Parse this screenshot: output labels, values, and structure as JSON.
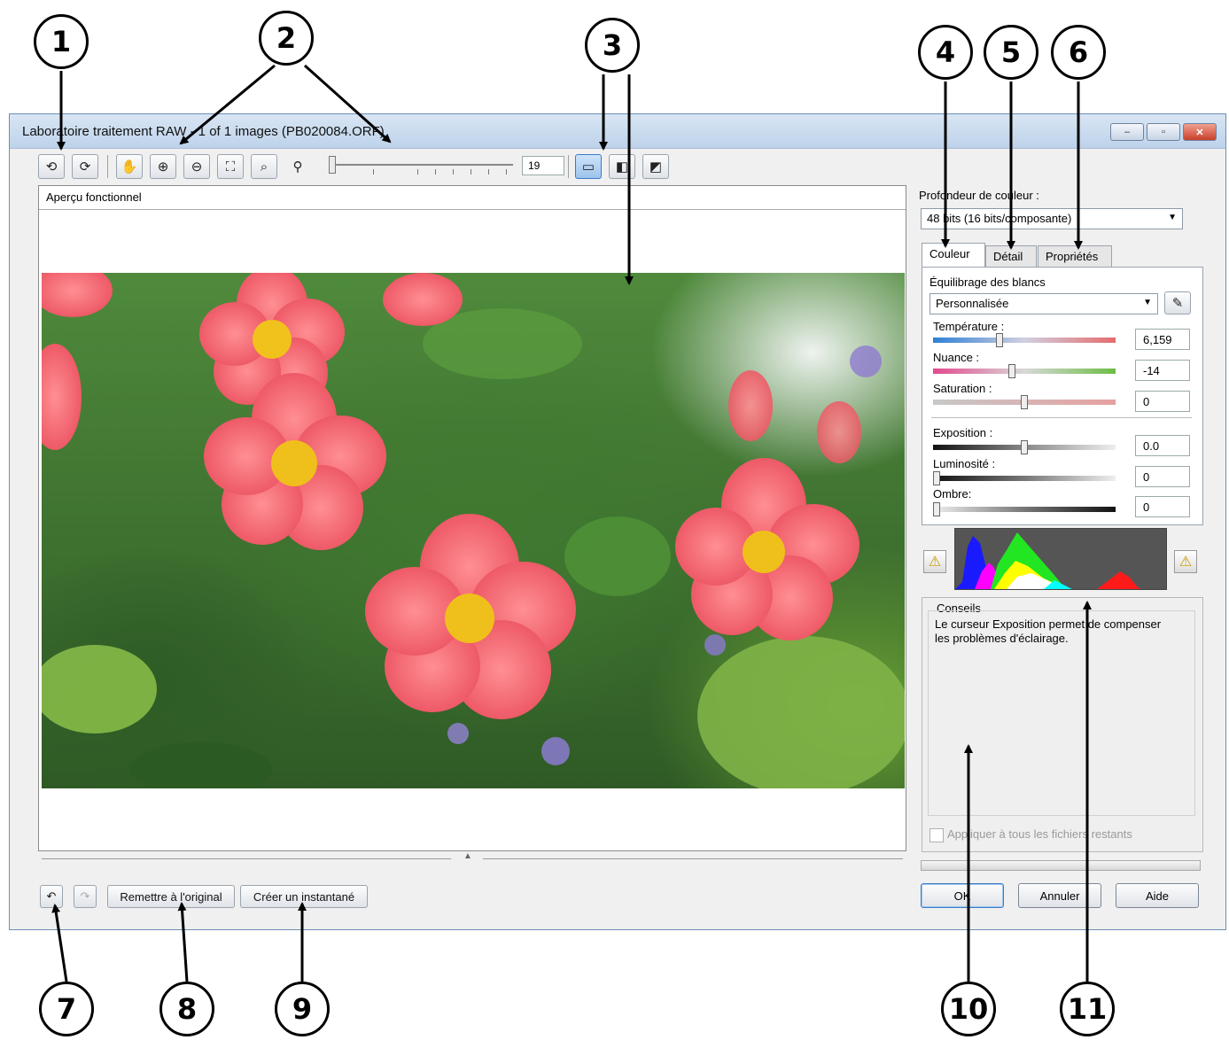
{
  "window": {
    "title": "Laboratoire traitement RAW - 1 of 1 images (PB020084.ORF)",
    "controls": [
      "–",
      "▫",
      "✕"
    ]
  },
  "toolbar": {
    "zoom_value": "19",
    "icons": [
      "rotate-left-icon",
      "rotate-right-icon",
      "hand-pan-icon",
      "zoom-in-icon",
      "zoom-out-icon",
      "fit-to-window-icon",
      "actual-size-icon",
      "zoom-icon",
      "single-view-icon",
      "split-view-icon",
      "before-after-view-icon"
    ]
  },
  "preview": {
    "label": "Aperçu fonctionnel"
  },
  "right_panel": {
    "color_depth_label": "Profondeur de couleur :",
    "color_depth_value": "48 bits (16 bits/composante)",
    "tabs": [
      "Couleur",
      "Détail",
      "Propriétés"
    ],
    "white_balance_label": "Équilibrage des blancs",
    "white_balance_value": "Personnalisée",
    "sliders": [
      {
        "label": "Température :",
        "value": "6,159",
        "level": 0.36
      },
      {
        "label": "Nuance :",
        "value": "-14",
        "level": 0.43
      },
      {
        "label": "Saturation :",
        "value": "0",
        "level": 0.5
      },
      {
        "label": "Exposition :",
        "value": "0.0",
        "level": 0.5
      },
      {
        "label": "Luminosité :",
        "value": "0",
        "level": 0.0
      },
      {
        "label": "Ombre:",
        "value": "0",
        "level": 0.0
      }
    ],
    "tips_title": "Conseils",
    "tips_text": "Le curseur Exposition permet de compenser les problèmes d'éclairage.",
    "apply_all_label": "Appliquer à tous les fichiers restants"
  },
  "bottom_bar": {
    "reset_label": "Remettre à l'original",
    "snapshot_label": "Créer un instantané"
  },
  "dialog_buttons": {
    "ok": "OK",
    "cancel": "Annuler",
    "help": "Aide"
  },
  "callouts": [
    "1",
    "2",
    "3",
    "4",
    "5",
    "6",
    "7",
    "8",
    "9",
    "10",
    "11"
  ]
}
